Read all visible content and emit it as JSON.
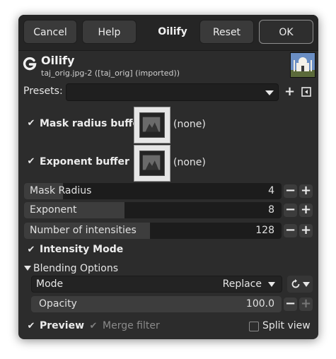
{
  "header": {
    "cancel_label": "Cancel",
    "help_label": "Help",
    "title": "Oilify",
    "reset_label": "Reset",
    "ok_label": "OK"
  },
  "operation": {
    "name": "Oilify",
    "source": "taj_orig.jpg-2 ([taj_orig] (imported))"
  },
  "presets": {
    "label": "Presets:",
    "value": ""
  },
  "mask_radius_buffer": {
    "checked": true,
    "label": "Mask radius buffer",
    "value": "(none)"
  },
  "exponent_buffer": {
    "checked": true,
    "label": "Exponent buffer",
    "value": "(none)"
  },
  "sliders": [
    {
      "label": "Mask Radius",
      "value": "4",
      "fraction": 0.15
    },
    {
      "label": "Exponent",
      "value": "8",
      "fraction": 0.39
    },
    {
      "label": "Number of intensities",
      "value": "128",
      "fraction": 0.49
    }
  ],
  "intensity_mode": {
    "checked": true,
    "label": "Intensity Mode"
  },
  "blending": {
    "section_label": "Blending Options",
    "mode_label": "Mode",
    "mode_value": "Replace",
    "opacity_label": "Opacity",
    "opacity_value": "100.0",
    "opacity_fraction": 1.0
  },
  "footer": {
    "preview_label": "Preview",
    "preview_checked": true,
    "merge_label": "Merge filter",
    "merge_checked": true,
    "merge_enabled": false,
    "split_label": "Split view",
    "split_checked": false
  },
  "colors": {
    "dialog_bg": "#2c2c2c",
    "header_bg": "#252525",
    "slider_fill": "#3d3d3d"
  }
}
